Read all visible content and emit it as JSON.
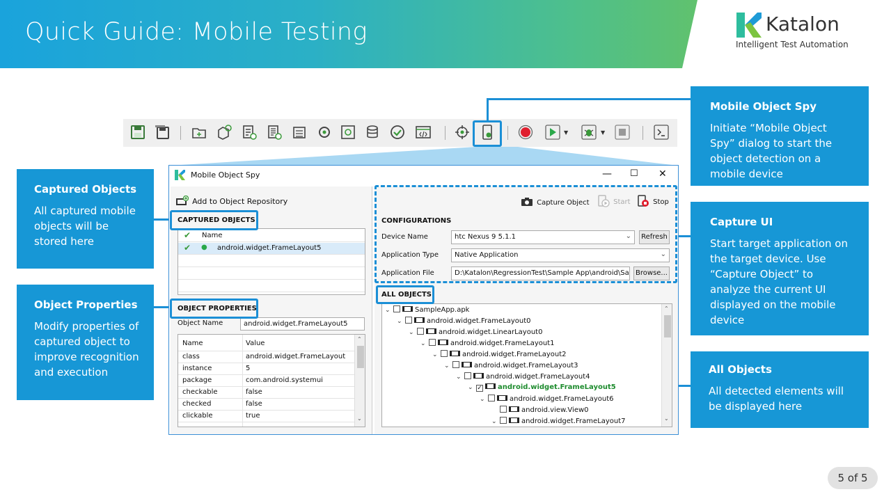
{
  "header": {
    "title": "Quick Guide: Mobile Testing",
    "brand": "Katalon",
    "tagline": "Intelligent Test Automation"
  },
  "colors": {
    "accent": "#1797d6",
    "highlight": "#1b8fd6",
    "tree_selected": "#1e8c2e"
  },
  "toolbar": {
    "icons": [
      "save-icon",
      "save-all-icon",
      "new-folder-icon",
      "new-object-icon",
      "new-test-case-icon",
      "new-test-suite-icon",
      "new-test-data-icon",
      "keyword-icon",
      "spy-web-icon",
      "database-icon",
      "check-icon",
      "code-icon",
      "record-web-icon",
      "mobile-spy-icon",
      "record-icon",
      "run-icon",
      "debug-icon",
      "stop-icon",
      "console-icon"
    ]
  },
  "callouts": {
    "mobile_spy": {
      "title": "Mobile Object Spy",
      "body": "Initiate “Mobile Object Spy” dialog to start the object detection on a mobile device"
    },
    "captured": {
      "title": "Captured Objects",
      "body": "All captured mobile objects will be stored here"
    },
    "properties": {
      "title": "Object Properties",
      "body": "Modify properties of captured object to improve recognition and execution"
    },
    "capture_ui": {
      "title": "Capture UI",
      "body": "Start target application on the target device. Use “Capture Object” to analyze the current UI displayed on the mobile device"
    },
    "all_objects": {
      "title": "All Objects",
      "body": "All detected elements will be displayed here"
    }
  },
  "window": {
    "title": "Mobile Object Spy",
    "add_repo": "Add to Object Repository",
    "captured_header": "CAPTURED OBJECTS",
    "captured_col": "Name",
    "captured_items": [
      "android.widget.FrameLayout5"
    ],
    "props_header": "OBJECT PROPERTIES",
    "object_name_label": "Object Name",
    "object_name_value": "android.widget.FrameLayout5",
    "props_cols": [
      "Name",
      "Value"
    ],
    "props": [
      [
        "class",
        "android.widget.FrameLayout"
      ],
      [
        "instance",
        "5"
      ],
      [
        "package",
        "com.android.systemui"
      ],
      [
        "checkable",
        "false"
      ],
      [
        "checked",
        "false"
      ],
      [
        "clickable",
        "true"
      ]
    ],
    "capture_object": "Capture Object",
    "start": "Start",
    "stop": "Stop",
    "config_header": "CONFIGURATIONS",
    "device_label": "Device Name",
    "device_value": "htc Nexus 9 5.1.1",
    "refresh": "Refresh",
    "app_type_label": "Application Type",
    "app_type_value": "Native Application",
    "app_file_label": "Application File",
    "app_file_value": "D:\\Katalon\\RegressionTest\\Sample App\\android\\Sar",
    "browse": "Browse...",
    "all_objects_header": "ALL OBJECTS",
    "tree": [
      "SampleApp.apk",
      "android.widget.FrameLayout0",
      "android.widget.LinearLayout0",
      "android.widget.FrameLayout1",
      "android.widget.FrameLayout2",
      "android.widget.FrameLayout3",
      "android.widget.FrameLayout4",
      "android.widget.FrameLayout5",
      "android.widget.FrameLayout6",
      "android.view.View0",
      "android.widget.FrameLayout7"
    ]
  },
  "page": "5 of 5"
}
